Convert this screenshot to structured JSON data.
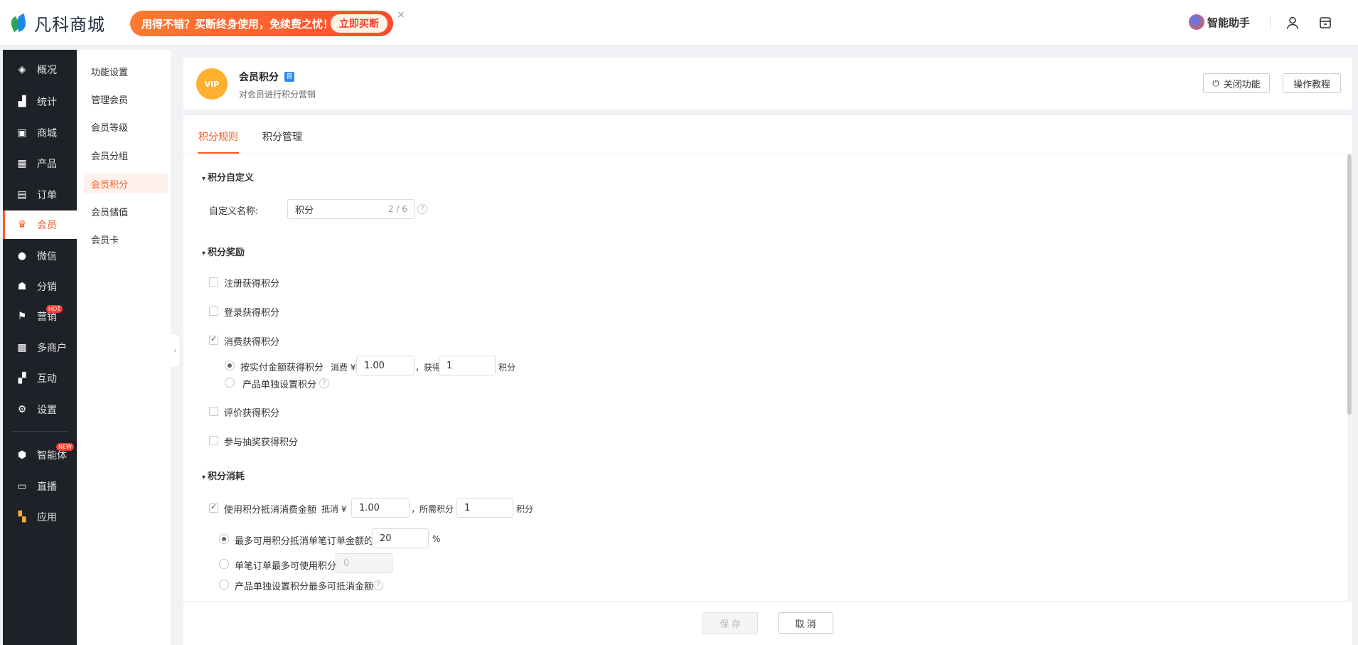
{
  "header": {
    "logo_text": "凡科商城",
    "promo_text": "用得不错？买断终身使用，免续费之忧！",
    "promo_button": "立即买断",
    "promo_close": "×",
    "assistant_label": "智能助手"
  },
  "leftnav": {
    "items": [
      {
        "label": "概况",
        "icon": "layers-icon"
      },
      {
        "label": "统计",
        "icon": "chart-icon"
      },
      {
        "label": "商城",
        "icon": "store-icon"
      },
      {
        "label": "产品",
        "icon": "grid-icon"
      },
      {
        "label": "订单",
        "icon": "clipboard-icon"
      },
      {
        "label": "会员",
        "icon": "crown-icon"
      },
      {
        "label": "微信",
        "icon": "chat-icon"
      },
      {
        "label": "分销",
        "icon": "users-icon"
      },
      {
        "label": "营销",
        "icon": "flag-icon"
      },
      {
        "label": "多商户",
        "icon": "merchant-icon"
      },
      {
        "label": "互动",
        "icon": "blocks-icon"
      },
      {
        "label": "设置",
        "icon": "gear-icon"
      },
      {
        "label": "智能体",
        "icon": "cube-icon"
      },
      {
        "label": "直播",
        "icon": "tv-icon"
      },
      {
        "label": "应用",
        "icon": "apps-icon"
      }
    ],
    "hot_badge": "HOT",
    "new_badge": "NEW"
  },
  "subnav": {
    "items": [
      "功能设置",
      "管理会员",
      "会员等级",
      "会员分组",
      "会员积分",
      "会员储值",
      "会员卡"
    ]
  },
  "page": {
    "icon_text": "VIP",
    "title": "会员积分",
    "title_tag": "普",
    "subtitle": "对会员进行积分营销",
    "close_feature": "关闭功能",
    "tutorial": "操作教程"
  },
  "tabs": [
    "积分规则",
    "积分管理"
  ],
  "custom": {
    "section_title": "积分自定义",
    "name_label": "自定义名称:",
    "name_value": "积分",
    "name_counter": "2 / 6"
  },
  "reward": {
    "section_title": "积分奖励",
    "register": "注册获得积分",
    "login": "登录获得积分",
    "consume": "消费获得积分",
    "by_amount": "按实付金额获得积分",
    "consume_prefix": "消费 ¥",
    "consume_amount": "1.00",
    "gain_prefix": "，获得",
    "gain_points": "1",
    "points_unit": "积分",
    "per_product": "产品单独设置积分",
    "review": "评价获得积分",
    "lottery": "参与抽奖获得积分"
  },
  "consumption": {
    "section_title": "积分消耗",
    "offset_label": "使用积分抵消消费金额",
    "offset_prefix": "抵消 ¥",
    "offset_amount": "1.00",
    "required_prefix": "，所需积分",
    "required_points": "1",
    "points_unit": "积分",
    "max_percent_label": "最多可用积分抵消单笔订单金额的",
    "max_percent_value": "20",
    "percent_sign": "%",
    "max_points_label": "单笔订单最多可使用积分",
    "max_points_placeholder": "0",
    "per_product_label": "产品单独设置积分最多可抵消金额"
  },
  "footer": {
    "save": "保 存",
    "cancel": "取 消"
  },
  "colors": {
    "accent": "#ff5a1f",
    "nav_bg": "#1f2128"
  }
}
